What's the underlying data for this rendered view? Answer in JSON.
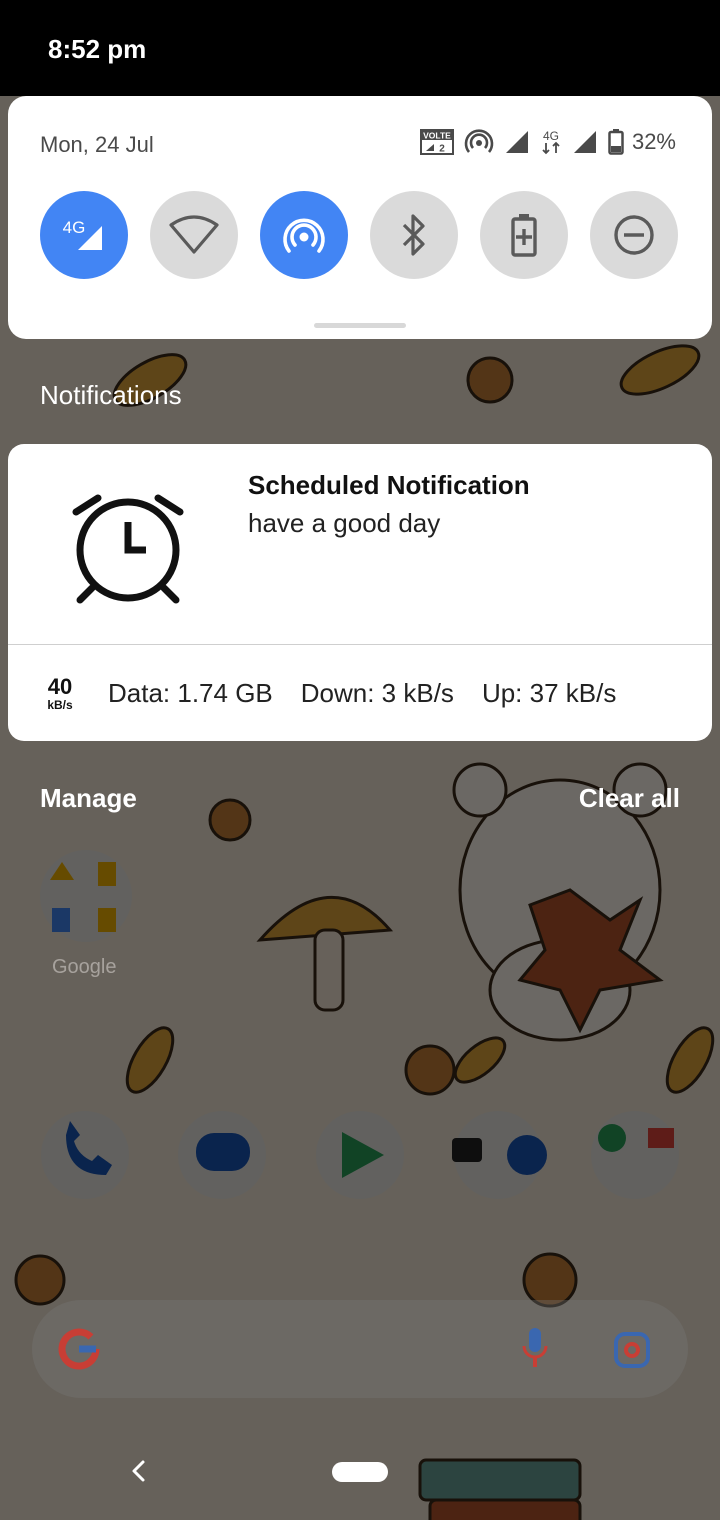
{
  "status_bar": {
    "time": "8:52 pm"
  },
  "quick_settings": {
    "date": "Mon, 24 Jul",
    "status_icons": [
      "volte-icon",
      "hotspot-icon",
      "signal-icon",
      "4g-icon",
      "signal-icon",
      "battery-icon"
    ],
    "volte_label": "VOLTE",
    "volte_sim": "2",
    "network_type": "4G",
    "battery_percent": "32%",
    "tiles": [
      {
        "name": "mobile-data",
        "label": "4G",
        "active": true
      },
      {
        "name": "wifi",
        "active": false
      },
      {
        "name": "hotspot",
        "active": true
      },
      {
        "name": "bluetooth",
        "active": false
      },
      {
        "name": "battery-saver",
        "active": false
      },
      {
        "name": "do-not-disturb",
        "active": false
      }
    ]
  },
  "notifications": {
    "header": "Notifications",
    "items": [
      {
        "icon": "alarm-clock-icon",
        "title": "Scheduled Notification",
        "text": "have a good day"
      }
    ],
    "network_monitor": {
      "speed_value": "40",
      "speed_unit": "kB/s",
      "data": "Data: 1.74 GB",
      "down": "Down: 3 kB/s",
      "up": "Up: 37 kB/s"
    },
    "manage_label": "Manage",
    "clear_all_label": "Clear all"
  },
  "home_screen": {
    "folder_label": "Google"
  },
  "colors": {
    "accent": "#4285f4",
    "tile_inactive": "#dadada",
    "panel_bg": "#ffffff"
  }
}
